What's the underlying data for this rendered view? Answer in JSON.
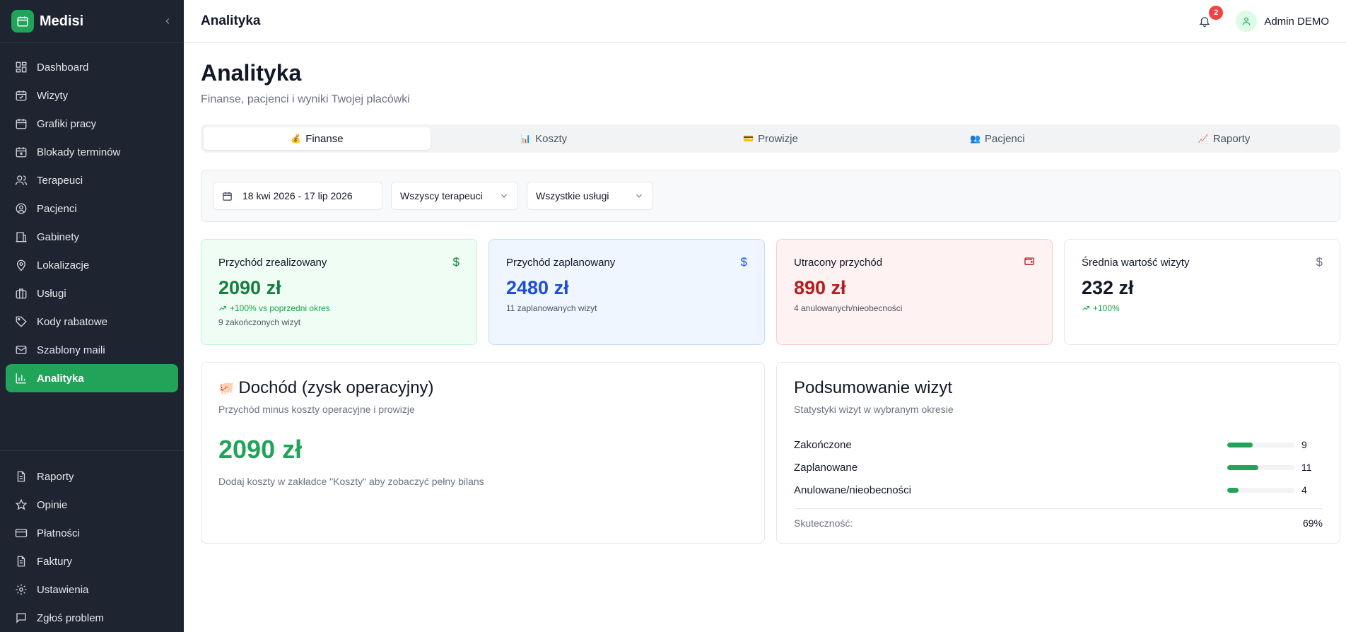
{
  "brand": {
    "name": "Medisi"
  },
  "sidebar": {
    "items": [
      {
        "label": "Dashboard",
        "icon": "dashboard-icon"
      },
      {
        "label": "Wizyty",
        "icon": "calendar-check-icon"
      },
      {
        "label": "Grafiki pracy",
        "icon": "calendar-grid-icon"
      },
      {
        "label": "Blokady terminów",
        "icon": "calendar-block-icon"
      },
      {
        "label": "Terapeuci",
        "icon": "users-icon"
      },
      {
        "label": "Pacjenci",
        "icon": "user-circle-icon"
      },
      {
        "label": "Gabinety",
        "icon": "building-icon"
      },
      {
        "label": "Lokalizacje",
        "icon": "map-pin-icon"
      },
      {
        "label": "Usługi",
        "icon": "briefcase-icon"
      },
      {
        "label": "Kody rabatowe",
        "icon": "tag-icon"
      },
      {
        "label": "Szablony maili",
        "icon": "mail-icon"
      },
      {
        "label": "Analityka",
        "icon": "bar-chart-icon",
        "active": true
      }
    ],
    "bottom": [
      {
        "label": "Raporty",
        "icon": "file-icon"
      },
      {
        "label": "Opinie",
        "icon": "star-icon"
      },
      {
        "label": "Płatności",
        "icon": "credit-card-icon"
      },
      {
        "label": "Faktury",
        "icon": "invoice-icon"
      },
      {
        "label": "Ustawienia",
        "icon": "gear-icon"
      },
      {
        "label": "Zgłoś problem",
        "icon": "message-icon"
      }
    ]
  },
  "topbar": {
    "title": "Analityka",
    "notifications": "2",
    "user": "Admin DEMO"
  },
  "page": {
    "title": "Analityka",
    "subtitle": "Finanse, pacjenci i wyniki Twojej placówki"
  },
  "tabs": [
    {
      "emoji": "💰",
      "label": "Finanse",
      "active": true
    },
    {
      "emoji": "📊",
      "label": "Koszty"
    },
    {
      "emoji": "💳",
      "label": "Prowizje"
    },
    {
      "emoji": "👥",
      "label": "Pacjenci"
    },
    {
      "emoji": "📈",
      "label": "Raporty"
    }
  ],
  "filters": {
    "date_range": "18 kwi 2026 - 17 lip 2026",
    "therapists": "Wszyscy terapeuci",
    "services": "Wszystkie usługi"
  },
  "stats": {
    "realized": {
      "label": "Przychód zrealizowany",
      "value": "2090 zł",
      "trend": "+100% vs poprzedni okres",
      "note": "9 zakończonych wizyt",
      "icon": "$"
    },
    "planned": {
      "label": "Przychód zaplanowany",
      "value": "2480 zł",
      "note": "11 zaplanowanych wizyt",
      "icon": "$"
    },
    "lost": {
      "label": "Utracony przychód",
      "value": "890 zł",
      "note": "4 anulowanych/nieobecności"
    },
    "average": {
      "label": "Średnia wartość wizyty",
      "value": "232 zł",
      "trend": "+100%",
      "icon": "$"
    }
  },
  "income": {
    "emoji": "🐖",
    "title": "Dochód (zysk operacyjny)",
    "subtitle": "Przychód minus koszty operacyjne i prowizje",
    "value": "2090 zł",
    "hint": "Dodaj koszty w zakładce \"Koszty\" aby zobaczyć pełny bilans"
  },
  "visits": {
    "title": "Podsumowanie wizyt",
    "subtitle": "Statystyki wizyt w wybranym okresie",
    "rows": [
      {
        "label": "Zakończone",
        "count": "9",
        "fraction": 0.375
      },
      {
        "label": "Zaplanowane",
        "count": "11",
        "fraction": 0.458
      },
      {
        "label": "Anulowane/nieobecności",
        "count": "4",
        "fraction": 0.167
      }
    ],
    "efficiency_label": "Skuteczność:",
    "efficiency_value": "69%"
  },
  "colors": {
    "accent": "#22a35a",
    "sidebar_bg": "#1e2430"
  }
}
